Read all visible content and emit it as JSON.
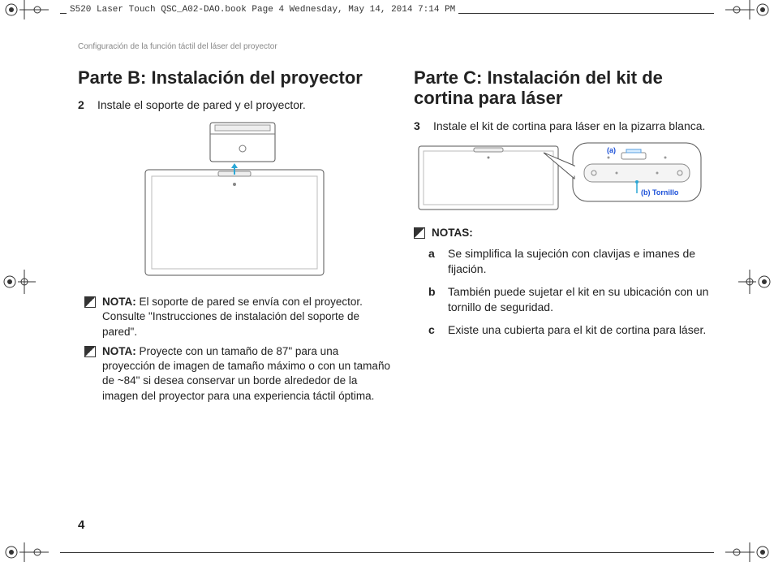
{
  "header": {
    "crop_info": "S520 Laser Touch QSC_A02-DAO.book  Page 4  Wednesday, May 14, 2014  7:14 PM"
  },
  "running_head": "Configuración de la función táctil del láser del proyector",
  "page_number": "4",
  "left": {
    "heading": "Parte B: Instalación del proyector",
    "step_num": "2",
    "step_text": "Instale el soporte de pared y el proyector.",
    "note1_label": "NOTA:",
    "note1_text": " El soporte de pared se envía con el proyector. Consulte \"Instrucciones de instalación del soporte de pared\".",
    "note2_label": "NOTA:",
    "note2_text": " Proyecte con un tamaño de 87\" para una proyección de imagen de tamaño máximo o con un tamaño de ~84\" si desea conservar un borde alrededor de la imagen del proyector para una experiencia táctil óptima."
  },
  "right": {
    "heading": "Parte C: Instalación del kit de cortina para láser",
    "step_num": "3",
    "step_text": "Instale el kit de cortina para láser en la pizarra blanca.",
    "callout_a": "(a)",
    "callout_b": "(b) Tornillo",
    "notes_label": "NOTAS:",
    "a_letter": "a",
    "a_text": "Se simplifica la sujeción con clavijas e imanes de fijación.",
    "b_letter": "b",
    "b_text": "También puede sujetar el kit en su ubicación con un tornillo de seguridad.",
    "c_letter": "c",
    "c_text": "Existe una cubierta para el kit de cortina para láser."
  }
}
